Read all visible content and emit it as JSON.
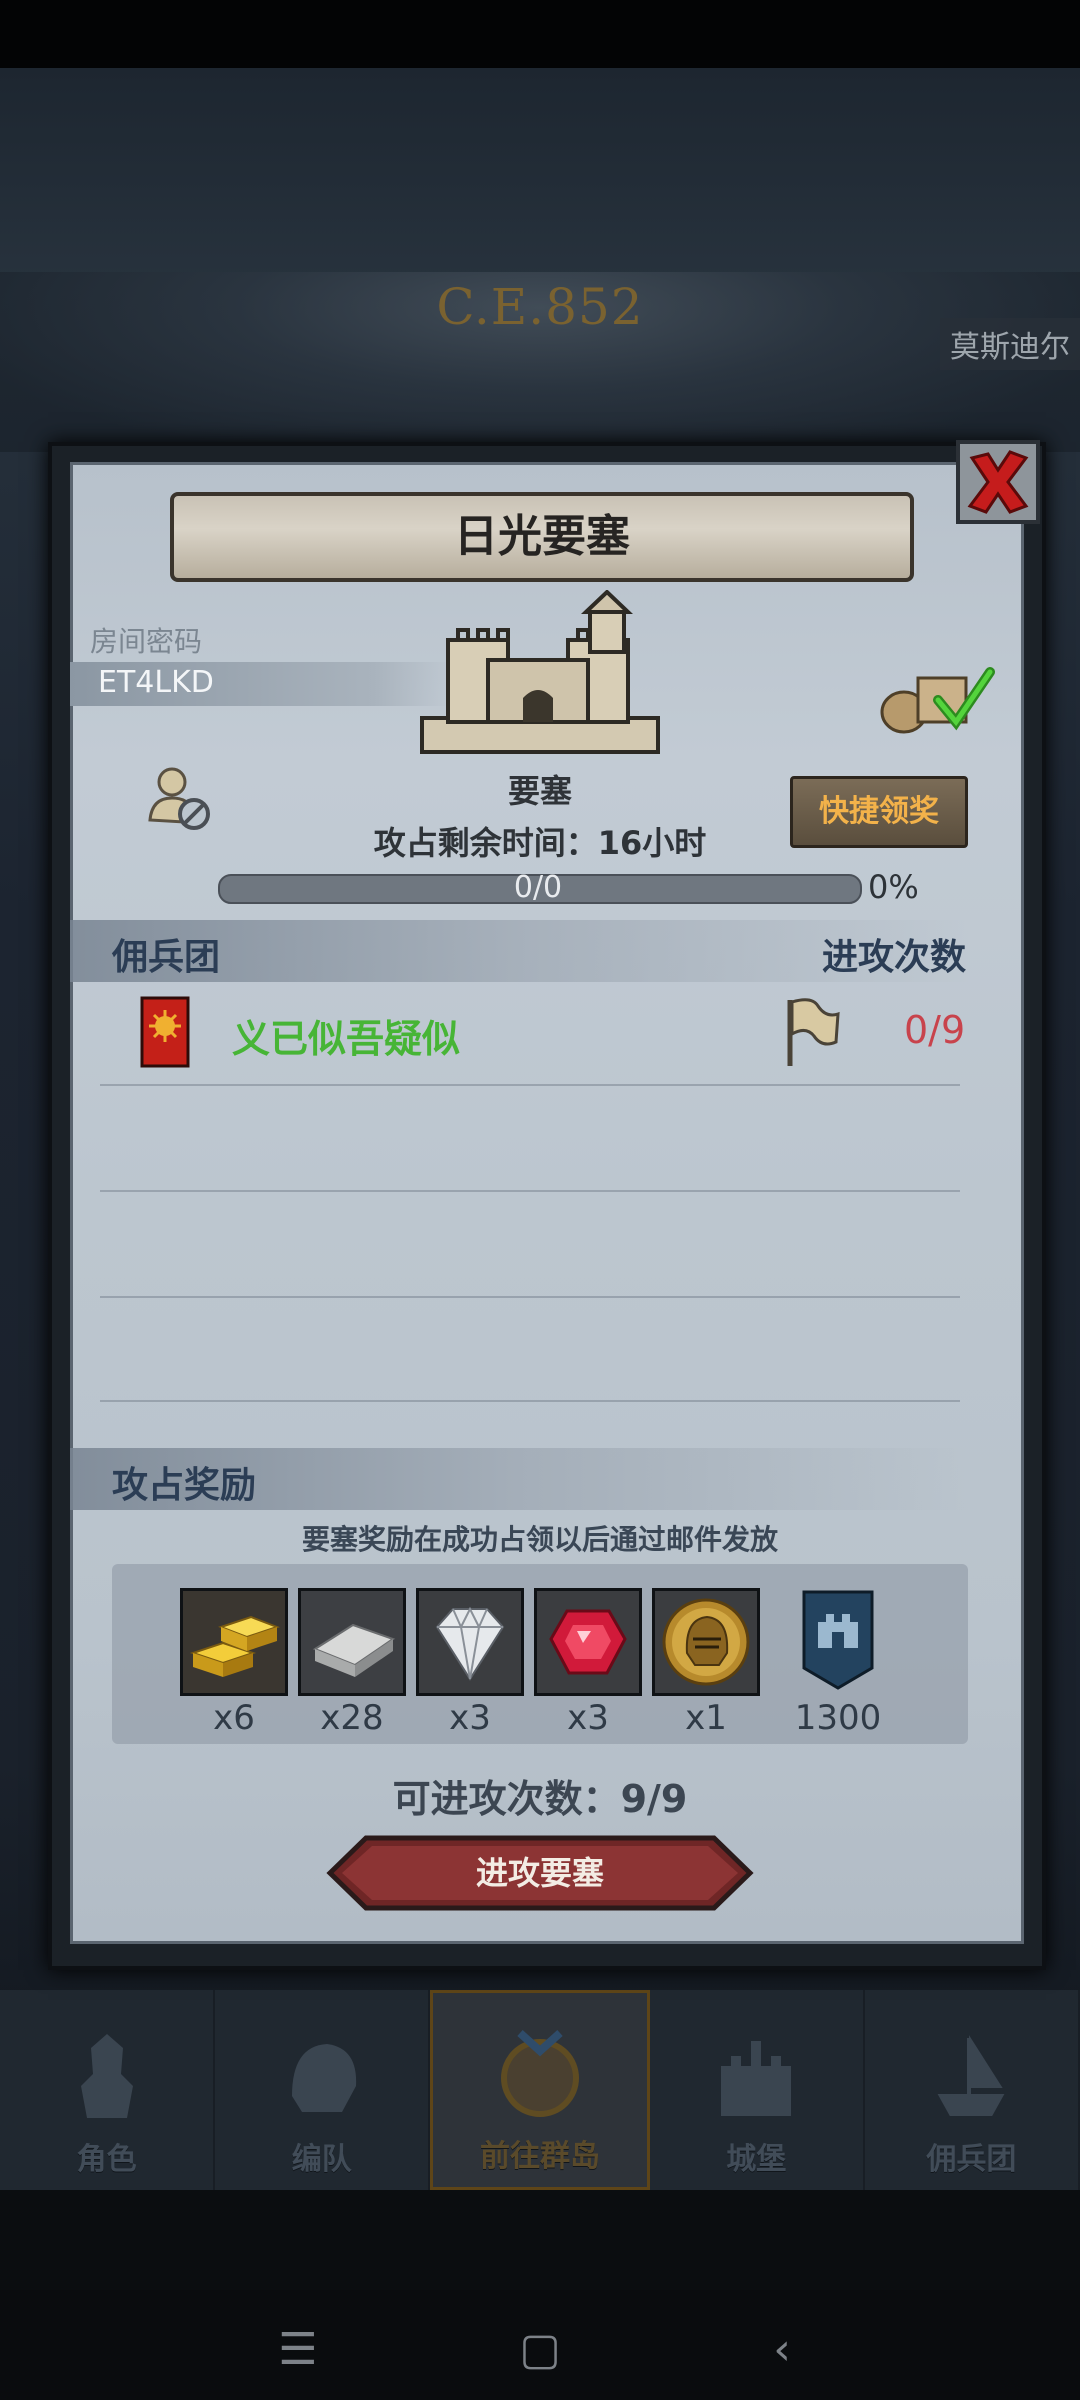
{
  "background": {
    "era": "C.E.852",
    "city": "莫斯迪尔",
    "nav": [
      {
        "label": "角色",
        "icon": "knight-icon"
      },
      {
        "label": "编队",
        "icon": "helmet-icon"
      },
      {
        "label": "前往群岛",
        "icon": "compass-icon"
      },
      {
        "label": "城堡",
        "icon": "castle-icon"
      },
      {
        "label": "佣兵团",
        "icon": "ship-icon"
      }
    ]
  },
  "dialog": {
    "title": "日光要塞",
    "room_code_label": "房间密码",
    "room_code": "ET4LKD",
    "fortress_label": "要塞",
    "time_left": "攻占剩余时间：16小时",
    "progress": {
      "text": "0/0",
      "percent_label": "0%",
      "fraction": 0
    },
    "quick_claim": "快捷领奖",
    "mercenary_header": "佣兵团",
    "attack_count_header": "进攻次数",
    "guild_row": {
      "name": "义已似吾疑似",
      "count": "0/9"
    },
    "reward_header": "攻占奖励",
    "reward_note": "要塞奖励在成功占领以后通过邮件发放",
    "rewards": [
      {
        "icon": "gold-bar-icon",
        "qty": "x6"
      },
      {
        "icon": "iron-bar-icon",
        "qty": "x28"
      },
      {
        "icon": "diamond-icon",
        "qty": "x3"
      },
      {
        "icon": "ruby-icon",
        "qty": "x3"
      },
      {
        "icon": "helmet-medal-icon",
        "qty": "x1"
      },
      {
        "icon": "banner-icon",
        "qty": "1300"
      }
    ],
    "attacks_available": "可进攻次数：9/9",
    "attack_button": "进攻要塞"
  },
  "colors": {
    "guild_name": "#47b536",
    "count_red": "#c8434c",
    "gold": "#d9a53a",
    "header_blue": "#2b3d55"
  }
}
